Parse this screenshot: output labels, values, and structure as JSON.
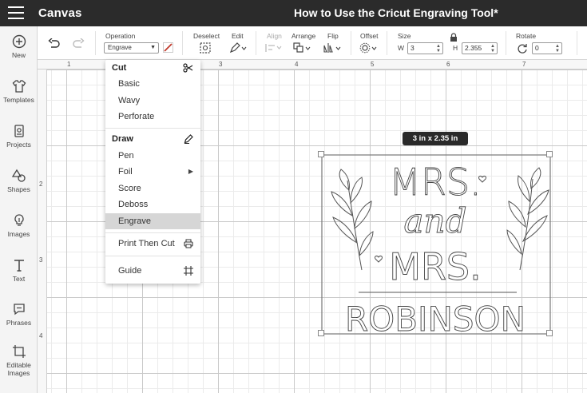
{
  "app": {
    "title": "Canvas",
    "document_title": "How to Use the Cricut Engraving Tool*"
  },
  "left_panel": [
    {
      "label": "New",
      "icon": "plus-circle-icon"
    },
    {
      "label": "Templates",
      "icon": "shirt-icon"
    },
    {
      "label": "Projects",
      "icon": "projects-icon"
    },
    {
      "label": "Shapes",
      "icon": "shapes-icon"
    },
    {
      "label": "Images",
      "icon": "lightbulb-icon"
    },
    {
      "label": "Text",
      "icon": "text-icon"
    },
    {
      "label": "Phrases",
      "icon": "speech-bubble-icon"
    },
    {
      "label": "Editable",
      "label2": "Images",
      "icon": "editable-images-icon"
    }
  ],
  "toolbar": {
    "operation_label": "Operation",
    "operation_value": "Engrave",
    "deselect_label": "Deselect",
    "edit_label": "Edit",
    "align_label": "Align",
    "arrange_label": "Arrange",
    "flip_label": "Flip",
    "offset_label": "Offset",
    "size_label": "Size",
    "width_letter": "W",
    "width_value": "3",
    "height_letter": "H",
    "height_value": "2.355",
    "rotate_label": "Rotate",
    "rotate_value": "0"
  },
  "rulers": {
    "top": [
      "1",
      "3",
      "4",
      "5",
      "6",
      "7"
    ],
    "left": [
      "2",
      "3",
      "4"
    ]
  },
  "operation_menu": {
    "cut_heading": "Cut",
    "cut_items": [
      "Basic",
      "Wavy",
      "Perforate"
    ],
    "draw_heading": "Draw",
    "draw_items": [
      "Pen",
      "Foil",
      "Score",
      "Deboss",
      "Engrave"
    ],
    "print_then_cut": "Print Then Cut",
    "guide": "Guide",
    "selected": "Engrave"
  },
  "design": {
    "dimensions_badge": "3  in x 2.35  in",
    "line1": "MRS.",
    "line2": "and",
    "line3": "MRS.",
    "line4": "ROBINSON"
  },
  "colors": {
    "topbar": "#2b2b2b",
    "panel": "#f4f4f4",
    "engrave_swatch": "#c0392b",
    "selected_row": "#d6d6d6"
  }
}
